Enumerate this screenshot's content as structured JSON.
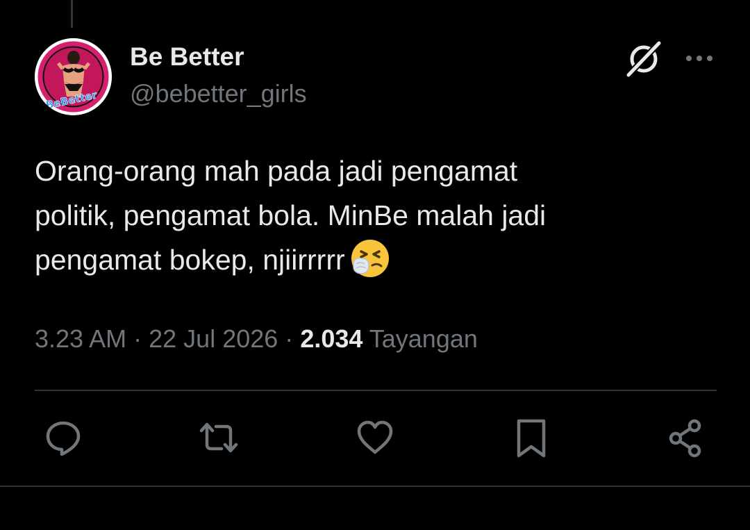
{
  "tweet": {
    "author": {
      "display_name": "Be Better",
      "handle": "@bebetter_girls",
      "avatar_text": "BeBetter"
    },
    "text_lines": [
      "Orang-orang mah pada jadi pengamat",
      "politik, pengamat bola. MinBe malah jadi",
      "pengamat bokep, njiirrrrr"
    ],
    "emoji": "sneezing-face",
    "time": "3.23 AM",
    "separator": "·",
    "date": "22 Jul 2026",
    "views_count": "2.034",
    "views_label": "Tayangan"
  },
  "icons": {
    "header": [
      "grok-icon",
      "more-icon"
    ],
    "actions": [
      "reply-icon",
      "retweet-icon",
      "like-icon",
      "bookmark-icon",
      "share-icon"
    ]
  },
  "colors": {
    "background": "#000000",
    "primary_text": "#e7e9ea",
    "secondary_text": "#71767b",
    "divider": "#2f3336",
    "avatar_accent": "#d61f6e"
  }
}
